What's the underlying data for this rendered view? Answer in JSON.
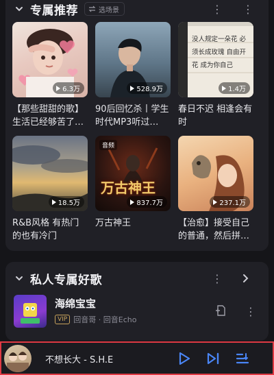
{
  "recommend": {
    "title": "专属推荐",
    "scene_label": "选场景",
    "playlists": [
      {
        "title": "【那些甜甜的歌】生活已经够苦了…",
        "plays": "6.3万"
      },
      {
        "title": "90后回忆杀丨学生时代MP3听过…",
        "plays": "528.9万"
      },
      {
        "title": "春日不迟 相逢会有时",
        "plays": "1.4万",
        "cover_text": "没人规定一朵花 必须长成玫瑰 自由开花 成为你自己"
      },
      {
        "title": "R&B风格 有热门的也有冷门",
        "plays": "18.5万"
      },
      {
        "title": "万古神王",
        "plays": "837.7万",
        "badge": "音频",
        "cover_text": "万古神王"
      },
      {
        "title": "【治愈】接受自己的普通，然后拼…",
        "plays": "237.1万"
      }
    ]
  },
  "private_section": {
    "title": "私人专属好歌",
    "song": {
      "title": "海绵宝宝",
      "vip_label": "VIP",
      "meta": "回音哥 · 回音Echo"
    }
  },
  "player": {
    "now_playing": "不想长大 - S.H.E"
  },
  "colors": {
    "accent_blue": "#4a86f7",
    "highlight_border": "#e03a44",
    "background": "#151519",
    "card": "#202026"
  }
}
